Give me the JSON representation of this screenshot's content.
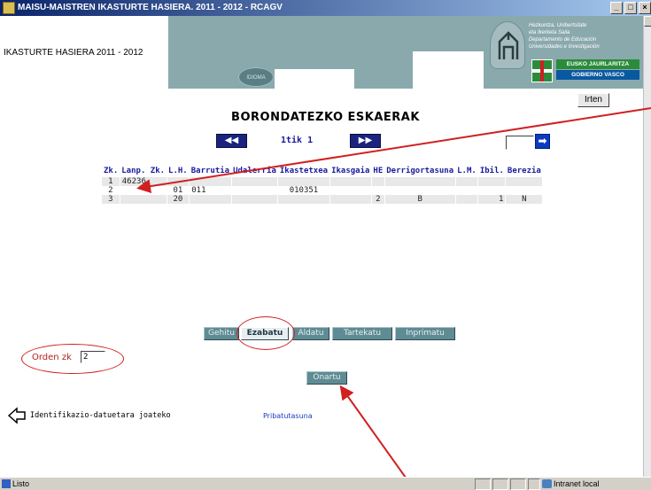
{
  "window": {
    "title": "MAISU-MAISTREN IKASTURTE HASIERA. 2011 - 2012 - RCAGV",
    "buttons": [
      "_",
      "□",
      "×"
    ]
  },
  "header": {
    "left_text": "IKASTURTE HASIERA 2011 - 2012",
    "language_button": "IDIOMA",
    "dept_lines": [
      "Hezkuntza, Unibertsitate",
      "eta Ikerketa Saila",
      "Departamento de Educación",
      "Universidades e Investigación"
    ],
    "gov_line1": "EUSKO JAURLARITZA",
    "gov_line2": "GOBIERNO VASCO"
  },
  "exit_button": "Irten",
  "page_title": "BORONDATEZKO ESKAERAK",
  "pager": {
    "prev_label": "◀◀",
    "next_label": "▶▶",
    "info": "1tik 1",
    "go_label": "➡",
    "goto_value": ""
  },
  "table": {
    "headers": [
      "Zk.",
      "Lanp. Zk.",
      "L.H.",
      "Barrutia",
      "Udalerria",
      "Ikastetxea",
      "Ikasgaia",
      "HE",
      "Derrigortasuna",
      "L.M.",
      "Ibil.",
      "Berezia"
    ],
    "rows": [
      [
        "1",
        "46236",
        "",
        "",
        "",
        "",
        "",
        "",
        "",
        "",
        "",
        ""
      ],
      [
        "2",
        "",
        "01",
        "011",
        "",
        "010351",
        "",
        "",
        "",
        "",
        "",
        ""
      ],
      [
        "3",
        "",
        "20",
        "",
        "",
        "",
        "",
        "2",
        "B",
        "",
        "1",
        "N"
      ]
    ]
  },
  "actions": {
    "gehitu": "Gehitu",
    "ezabatu": "Ezabatu",
    "aldatu": "Aldatu",
    "tartekatu": "Tartekatu",
    "inprimatu": "Inprimatu"
  },
  "orden": {
    "label": "Orden zk",
    "value": "2"
  },
  "confirm_button": "Onartu",
  "footer": {
    "back_link": "Identifikazio-datuetara joateko",
    "privacy_link": "Pribatutasuna"
  },
  "status": {
    "text": "Listo",
    "zone": "Intranet local"
  },
  "colors": {
    "banner": "#8aa9ad",
    "action_button": "#5f8b94",
    "nav_button": "#1a237e",
    "annotation": "#d02020"
  }
}
